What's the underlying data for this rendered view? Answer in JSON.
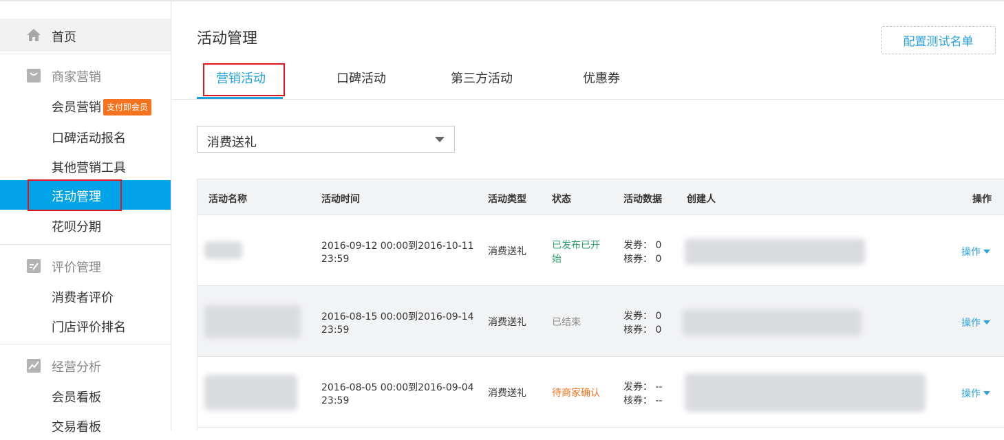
{
  "sidebar": {
    "home": "首页",
    "groups": [
      {
        "label": "商家营销",
        "items": [
          "会员营销",
          "口碑活动报名",
          "其他营销工具",
          "活动管理",
          "花呗分期"
        ]
      },
      {
        "label": "评价管理",
        "items": [
          "消费者评价",
          "门店评价排名"
        ]
      },
      {
        "label": "经营分析",
        "items": [
          "会员看板",
          "交易看板"
        ]
      }
    ],
    "badge": "支付即会员",
    "active_item": "活动管理"
  },
  "header": {
    "title": "活动管理",
    "config_button": "配置测试名单"
  },
  "tabs": [
    "营销活动",
    "口碑活动",
    "第三方活动",
    "优惠券"
  ],
  "active_tab": "营销活动",
  "filter": {
    "selected": "消费送礼"
  },
  "table": {
    "columns": [
      "活动名称",
      "活动时间",
      "活动类型",
      "状态",
      "活动数据",
      "创建人",
      "操作"
    ],
    "rows": [
      {
        "time_line1": "2016-09-12 00:00到2016-10-11",
        "time_line2": "23:59",
        "type": "消费送礼",
        "status_line1": "已发布已开",
        "status_line2": "始",
        "issued": "发券： 0",
        "redeemed": "核券： 0",
        "action": "操作"
      },
      {
        "time_line1": "2016-08-15 00:00到2016-09-14",
        "time_line2": "23:59",
        "type": "消费送礼",
        "status_line1": "已结束",
        "status_line2": "",
        "issued": "发券： 0",
        "redeemed": "核券： 0",
        "action": "操作"
      },
      {
        "time_line1": "2016-08-05 00:00到2016-09-04",
        "time_line2": "23:59",
        "type": "消费送礼",
        "status_line1": "待商家确认",
        "status_line2": "",
        "issued": "发券： --",
        "redeemed": "核券： --",
        "action": "操作"
      }
    ]
  },
  "colors": {
    "accent": "#00a3e8",
    "link": "#2aa2dd",
    "status_active": "#2aa06b",
    "status_ended": "#888888",
    "status_pending": "#f5731f",
    "highlight_box": "#e3151a"
  }
}
